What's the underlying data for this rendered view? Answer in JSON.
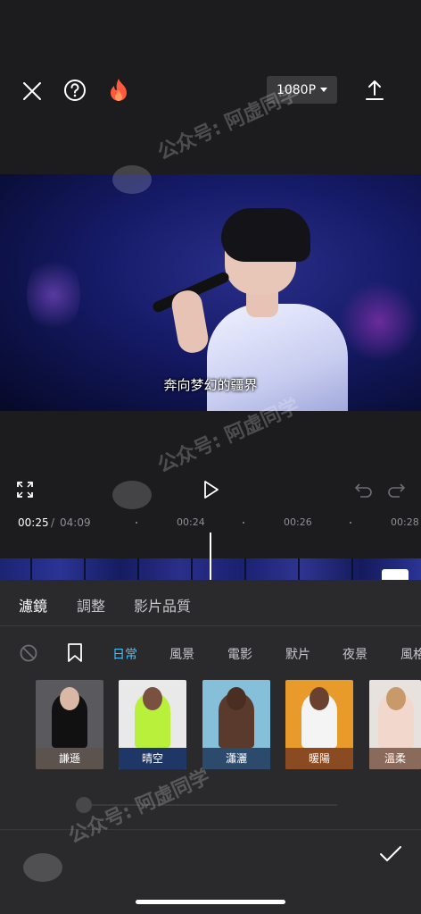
{
  "toolbar": {
    "resolution": "1080P"
  },
  "video": {
    "subtitle": "奔向梦幻的疆界"
  },
  "timeline": {
    "current": "00:25",
    "separator": "/",
    "total": "04:09",
    "ticks": [
      "00:24",
      "00:26",
      "00:28"
    ]
  },
  "tabs": {
    "filter": "濾鏡",
    "adjust": "調整",
    "quality": "影片品質"
  },
  "categories": [
    "日常",
    "風景",
    "電影",
    "默片",
    "夜景",
    "風格"
  ],
  "filters": [
    {
      "label": "謙遜",
      "bg": "#5a5a5e",
      "label_bg": "#5c534f"
    },
    {
      "label": "晴空",
      "bg": "#e9e9ea",
      "label_bg": "#1f3766"
    },
    {
      "label": "瀟灑",
      "bg": "#86bfd9",
      "label_bg": "#2c4a6b"
    },
    {
      "label": "暖陽",
      "bg": "#e89a2a",
      "label_bg": "#8a4a22"
    },
    {
      "label": "溫柔",
      "bg": "#e7e2de",
      "label_bg": "#8a6a5a"
    }
  ],
  "watermark": "公众号: 阿虚同学",
  "colors": {
    "accent": "#3ec4ff",
    "background": "#1c1c1e",
    "panel": "#2a2a2c"
  }
}
